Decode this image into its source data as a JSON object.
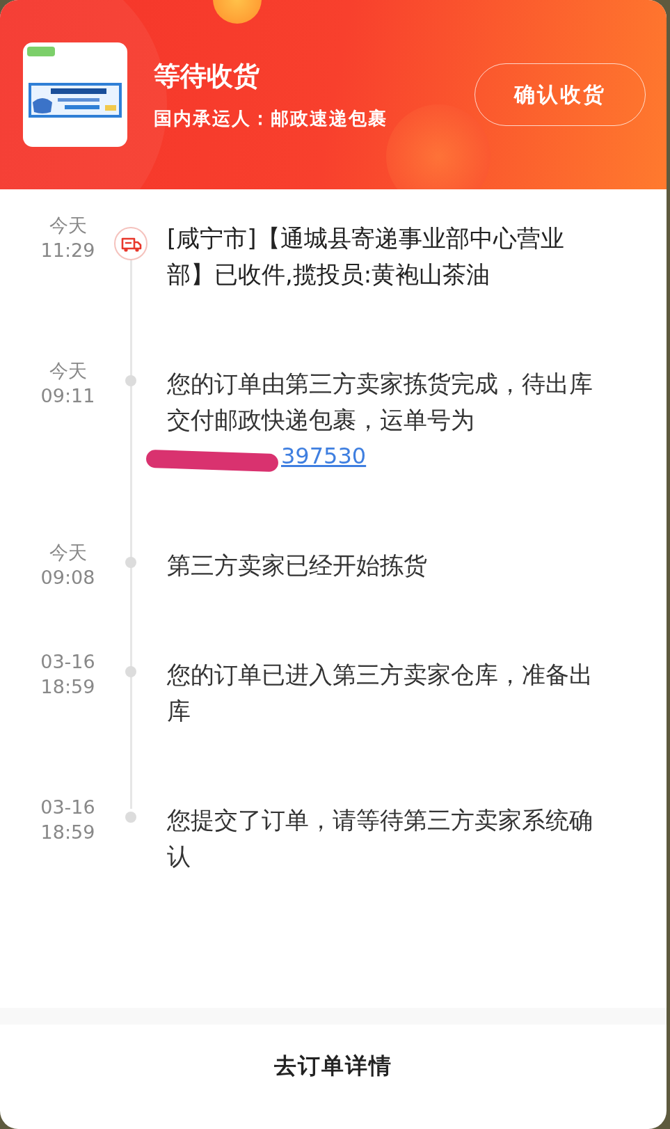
{
  "header": {
    "status": "等待收货",
    "carrier": "国内承运人：邮政速递包裹",
    "confirm_button": "确认收货"
  },
  "timeline": [
    {
      "date": "今天",
      "time": "11:29",
      "current": true,
      "text": "[咸宁市]【通城县寄递事业部中心营业部】已收件,揽投员:黄袍山茶油"
    },
    {
      "date": "今天",
      "time": "09:11",
      "current": false,
      "text": "您的订单由第三方卖家拣货完成，待出库交付邮政快递包裹，运单号为",
      "link": "397530",
      "redacted": true
    },
    {
      "date": "今天",
      "time": "09:08",
      "current": false,
      "text": "第三方卖家已经开始拣货"
    },
    {
      "date": "03-16",
      "time": "18:59",
      "current": false,
      "text": "您的订单已进入第三方卖家仓库，准备出库"
    },
    {
      "date": "03-16",
      "time": "18:59",
      "current": false,
      "text": "您提交了订单，请等待第三方卖家系统确认"
    }
  ],
  "footer": {
    "link": "去订单详情"
  }
}
